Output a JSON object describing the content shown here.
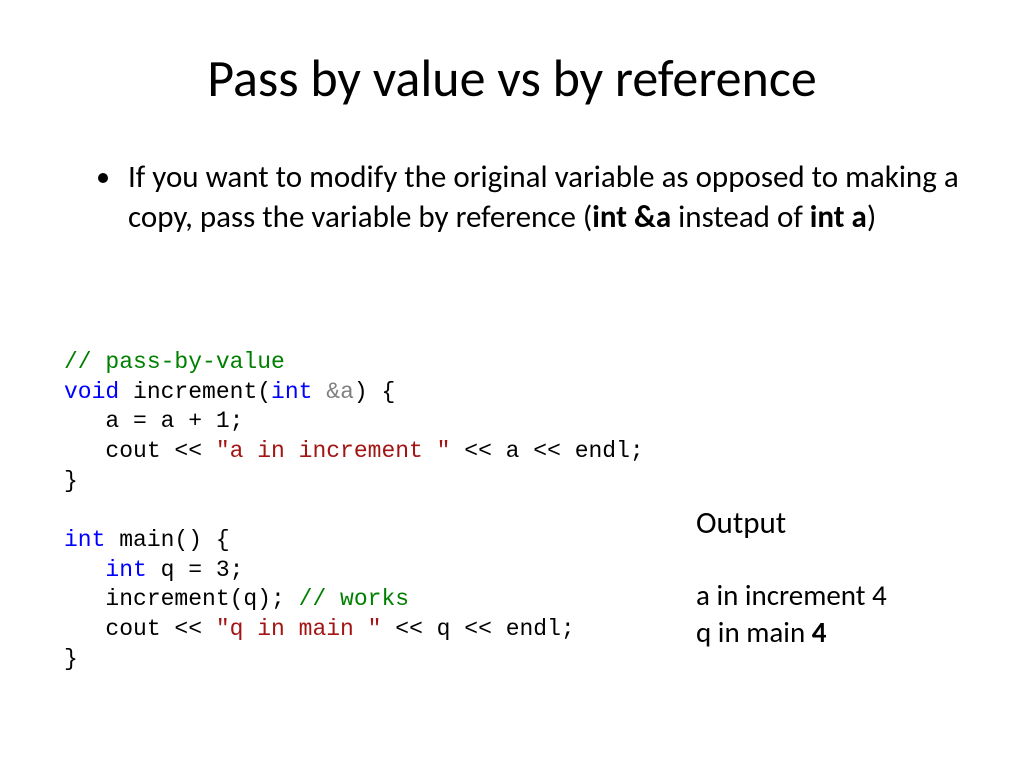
{
  "title": "Pass by value vs by reference",
  "bullet": {
    "pre": "If you want to modify the original variable as opposed to making a copy, pass the variable by reference (",
    "bold1": "int &a",
    "mid": " instead of ",
    "bold2": "int a",
    "post": ")"
  },
  "code": {
    "l1": "// pass-by-value",
    "l2a": "void",
    "l2b": " increment(",
    "l2c": "int ",
    "l2d": "&a",
    "l2e": ") {",
    "l3": "   a = a + 1;",
    "l4a": "   cout << ",
    "l4b": "\"a in increment \"",
    "l4c": " << a << endl;",
    "l5": "}",
    "l6": "",
    "l7a": "int",
    "l7b": " main() {",
    "l8a": "   ",
    "l8b": "int",
    "l8c": " q = 3;",
    "l9a": "   increment(q); ",
    "l9b": "// works",
    "l10a": "   cout << ",
    "l10b": "\"q in main \"",
    "l10c": " << q << endl;",
    "l11": "}"
  },
  "output": {
    "heading": "Output",
    "line1a": "a in increment ",
    "line1b": "4",
    "line2a": "q in main ",
    "line2b": "4"
  }
}
